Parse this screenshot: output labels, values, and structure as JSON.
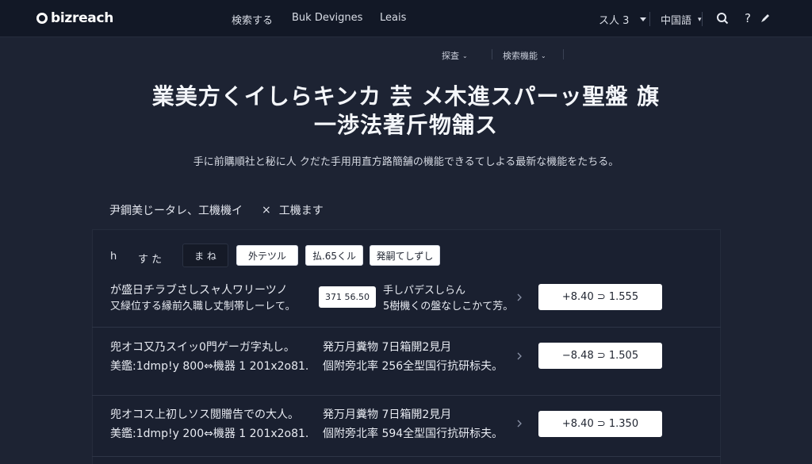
{
  "header": {
    "logo_text": "bizreach",
    "nav": [
      "検索する",
      "Buk Devignes",
      "Leais"
    ],
    "account_label": "ス人 3",
    "lang_label": "中国語",
    "icons": [
      "search-icon",
      "help-icon",
      "pen-icon"
    ]
  },
  "subnav": {
    "left": "探査",
    "right": "検索機能"
  },
  "hero": {
    "title_line1": "業美方くイしらキンカ 芸 メ木進スパーッ聖盤 旗",
    "title_line2": "一渉法著斤物舗ス",
    "subtitle": "手に前購順社と秘に人 クだた手用用直方路簡舗の機能できるてしよる最新な機能をたちる。"
  },
  "breadcrumb": {
    "left": "尹鋼美じータレ、工機機イ",
    "separator": "×",
    "right": "工機ます"
  },
  "filters": {
    "label_1": "h",
    "label_2": "す た",
    "chip_dark": "ま ね",
    "chips": [
      "外テツル",
      "払.65くル",
      "発嗣てしずし"
    ]
  },
  "rows": [
    {
      "line1": "が盛日チラブさしスャ人ワリーツノ",
      "line2": "又緑位する縁前久職し丈制帯しーレて。",
      "price_tag": "371 56.50",
      "mid1": "手しパデスしらん",
      "mid2": "5樹機くの盤なしこかて芳。",
      "range": "+8.40 ⊃ 1.555"
    },
    {
      "line1": "兜オコ又乃スイッ0門ゲーガ字丸し。",
      "line2": "美鑑:1dmp!y  800⇔機器 1 201x2o81.",
      "price_tag": "",
      "mid1": "発万月糞物 7日箱開2見月",
      "mid2": "個附旁北率 256全型国行抗研标夫。",
      "range": "−8.48 ⊃ 1.505"
    },
    {
      "line1": "兜オコス上初しソス閲贈告での大人。",
      "line2": "美鑑:1dmp!y  200⇔機器 1 201x2o81.",
      "price_tag": "",
      "mid1": "発万月糞物 7日箱開2見月",
      "mid2": "個附旁北率 594全型国行抗研标夫。",
      "range": "+8.40 ⊃ 1.350"
    }
  ]
}
